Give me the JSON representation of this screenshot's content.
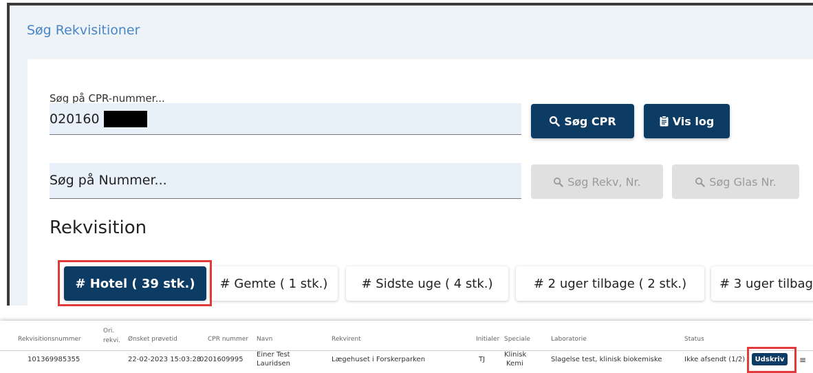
{
  "page": {
    "title": "Søg Rekvisitioner"
  },
  "cpr_search": {
    "label": "Søg på CPR-nummer...",
    "value": "020160",
    "search_button": "Søg CPR",
    "log_button": "Vis log"
  },
  "number_search": {
    "placeholder": "Søg på Nummer...",
    "rekv_button": "Søg Rekv, Nr.",
    "glas_button": "Søg Glas Nr."
  },
  "section": {
    "title": "Rekvisition"
  },
  "tabs": [
    {
      "label": "# Hotel ( 39 stk.)"
    },
    {
      "label": "# Gemte ( 1 stk.)"
    },
    {
      "label": "# Sidste uge ( 4 stk.)"
    },
    {
      "label": "# 2 uger tilbage ( 2 stk.)"
    },
    {
      "label": "# 3 uger tilbag"
    }
  ],
  "table": {
    "headers": {
      "rekv_nr": "Rekvisitionsnummer",
      "ori_line1": "Ori.",
      "ori_line2": "rekvi.",
      "proevetid": "Ønsket prøvetid",
      "cpr": "CPR nummer",
      "navn": "Navn",
      "rekvirent": "Rekvirent",
      "initialer": "Initialer",
      "speciale": "Speciale",
      "laboratorie": "Laboratorie",
      "status": "Status"
    },
    "rows": [
      {
        "rekv_nr": "101369985355",
        "proevetid": "22-02-2023 15:03:28",
        "cpr": "0201609995",
        "navn_line1": "Einer Test",
        "navn_line2": "Lauridsen",
        "rekvirent": "Lægehuset i Forskerparken",
        "initialer": "TJ",
        "speciale_line1": "Klinisk",
        "speciale_line2": "Kemi",
        "laboratorie": "Slagelse test, klinisk biokemiske",
        "status": "Ikke afsendt (1/2)",
        "action": "Udskriv"
      }
    ]
  },
  "colors": {
    "primary": "#0c3b64",
    "title_blue": "#4a86c5",
    "field_bg": "#e8f0fa",
    "highlight": "#e03a3a"
  }
}
